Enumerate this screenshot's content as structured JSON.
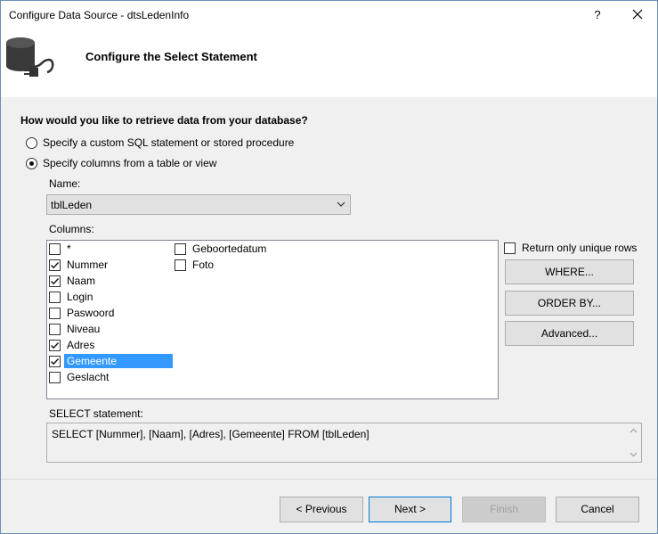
{
  "window": {
    "title": "Configure Data Source - dtsLedenInfo",
    "help_label": "?"
  },
  "header": {
    "heading": "Configure the Select Statement",
    "icon": "database-plug-icon"
  },
  "form": {
    "question": "How would you like to retrieve data from your database?",
    "options": [
      {
        "label": "Specify a custom SQL statement or stored procedure",
        "checked": false
      },
      {
        "label": "Specify columns from a table or view",
        "checked": true
      }
    ],
    "name_label": "Name:",
    "name_value": "tblLeden",
    "columns_label": "Columns:",
    "columns": [
      {
        "label": "*",
        "checked": false
      },
      {
        "label": "Nummer",
        "checked": true
      },
      {
        "label": "Naam",
        "checked": true
      },
      {
        "label": "Login",
        "checked": false
      },
      {
        "label": "Paswoord",
        "checked": false
      },
      {
        "label": "Niveau",
        "checked": false
      },
      {
        "label": "Adres",
        "checked": true
      },
      {
        "label": "Gemeente",
        "checked": true,
        "selected": true
      },
      {
        "label": "Geslacht",
        "checked": false
      },
      {
        "label": "Geboortedatum",
        "checked": false
      },
      {
        "label": "Foto",
        "checked": false
      }
    ],
    "unique_rows_label": "Return only unique rows",
    "unique_rows_checked": false,
    "where_label": "WHERE...",
    "orderby_label": "ORDER BY...",
    "advanced_label": "Advanced...",
    "select_label": "SELECT statement:",
    "select_value": "SELECT [Nummer], [Naam], [Adres], [Gemeente] FROM [tblLeden]"
  },
  "footer": {
    "previous_label": "< Previous",
    "next_label": "Next >",
    "finish_label": "Finish",
    "cancel_label": "Cancel"
  },
  "colors": {
    "selection": "#3399ff",
    "default_button_border": "#0078d7",
    "dialog_bg": "#f0f0f0"
  }
}
